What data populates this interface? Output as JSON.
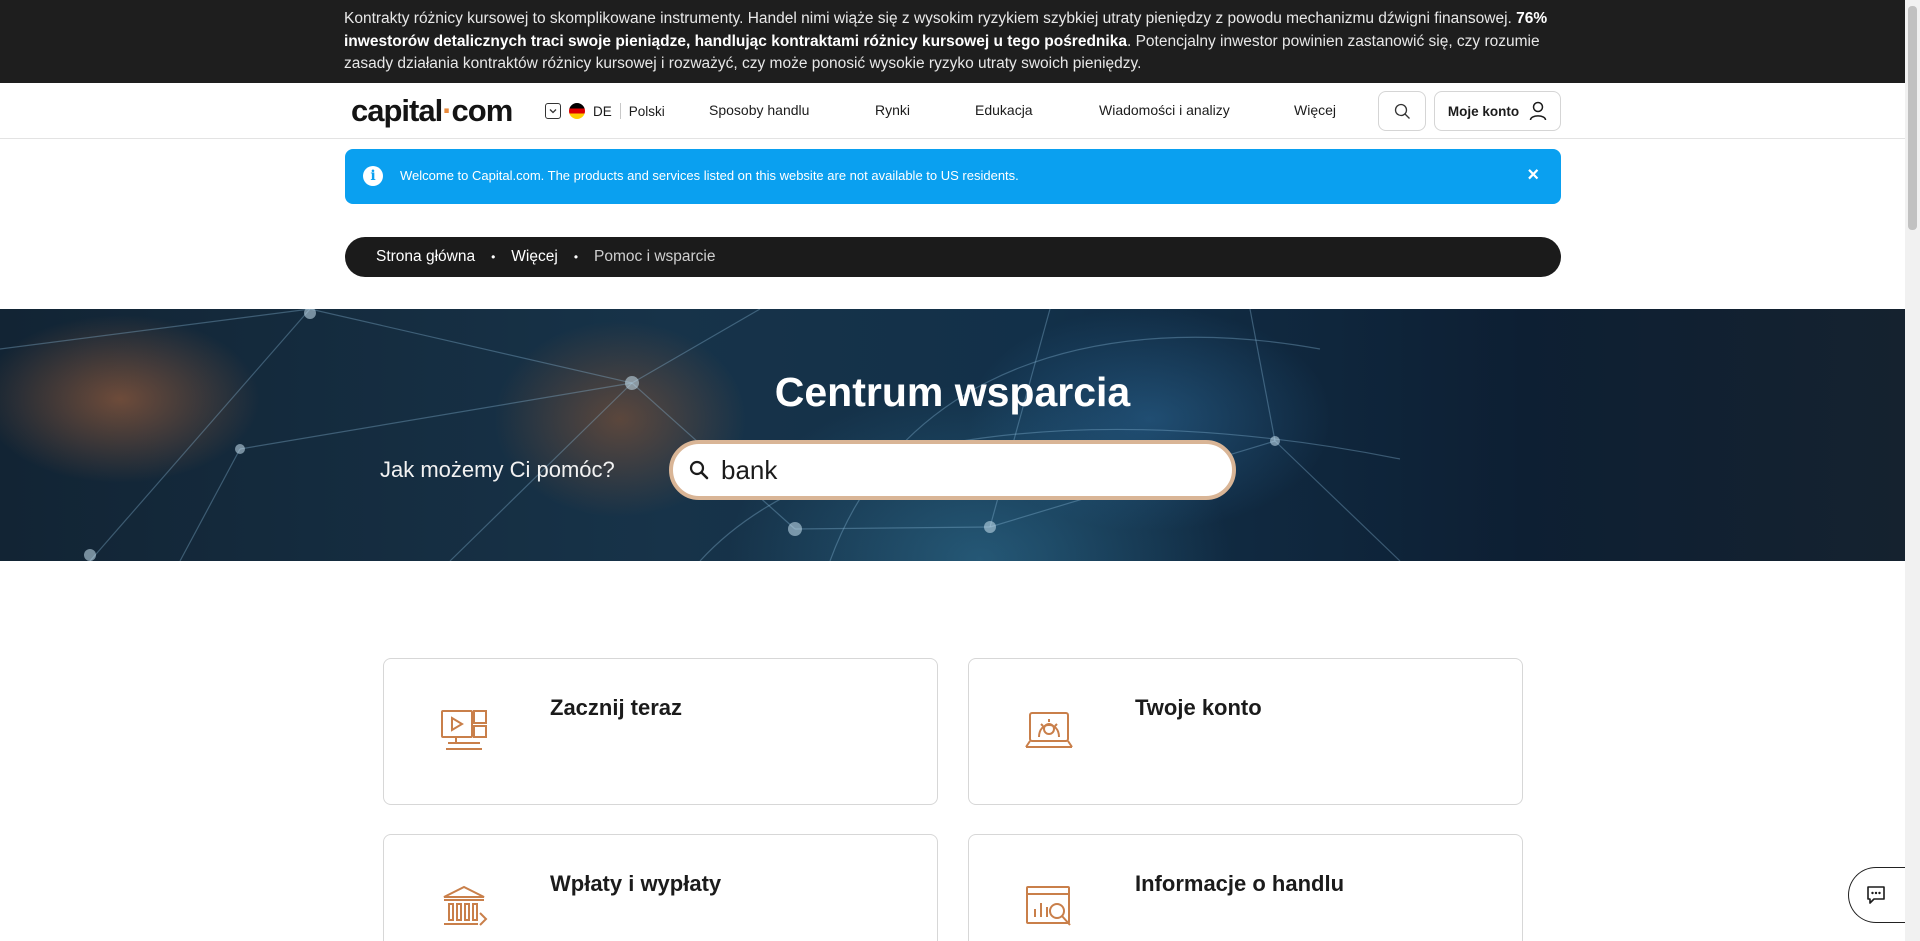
{
  "risk_warning": {
    "text_before": "Kontrakty różnicy kursowej to skomplikowane instrumenty. Handel nimi wiąże się z wysokim ryzykiem szybkiej utraty pieniędzy z powodu mechanizmu dźwigni finansowej. ",
    "bold": "76% inwestorów detalicznych traci swoje pieniądze, handlując kontraktami różnicy kursowej u tego pośrednika",
    "text_after": ". Potencjalny inwestor powinien zastanowić się, czy rozumie zasady działania kontraktów różnicy kursowej i rozważyć, czy może ponosić wysokie ryzyko utraty swoich pieniędzy."
  },
  "header": {
    "logo": {
      "part1": "capital",
      "dot": "·",
      "part2": "com"
    },
    "language": {
      "country_code": "DE",
      "language": "Polski"
    },
    "nav": [
      "Sposoby handlu",
      "Rynki",
      "Edukacja",
      "Wiadomości i analizy",
      "Więcej"
    ],
    "account_label": "Moje konto"
  },
  "notice": {
    "text": "Welcome to Capital.com. The products and services listed on this website are not available to US residents.",
    "close": "×"
  },
  "breadcrumb": [
    {
      "label": "Strona główna",
      "sep": "•"
    },
    {
      "label": "Więcej",
      "sep": "•"
    },
    {
      "label": "Pomoc i wsparcie"
    }
  ],
  "hero": {
    "title": "Centrum wsparcia",
    "question": "Jak możemy Ci pomóc?",
    "search_value": "bank"
  },
  "cards": [
    {
      "title": "Zacznij teraz",
      "icon": "monitor-play-icon"
    },
    {
      "title": "Twoje konto",
      "icon": "laptop-gear-icon"
    },
    {
      "title": "Wpłaty i wypłaty",
      "icon": "bank-transfer-icon"
    },
    {
      "title": "Informacje o handlu",
      "icon": "chart-magnifier-icon"
    }
  ],
  "colors": {
    "accent": "#c97f4a",
    "notice_blue": "#0aa0f0",
    "dark": "#1b1b1b"
  }
}
